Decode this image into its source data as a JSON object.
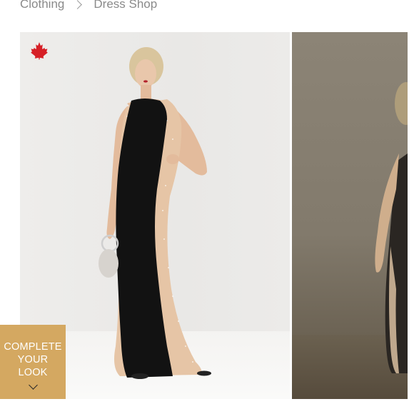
{
  "breadcrumb": {
    "items": [
      "Clothing",
      "Dress Shop"
    ]
  },
  "icons": {
    "separator": "chevron-right-icon",
    "flag": "maple-leaf-icon",
    "cta_arrow": "chevron-down-icon"
  },
  "cta": {
    "lines": [
      "COMPLETE",
      "YOUR",
      "LOOK"
    ]
  },
  "colors": {
    "accent": "#d4a861",
    "flag_red": "#d61f26",
    "breadcrumb_text": "#8a8a8a"
  }
}
